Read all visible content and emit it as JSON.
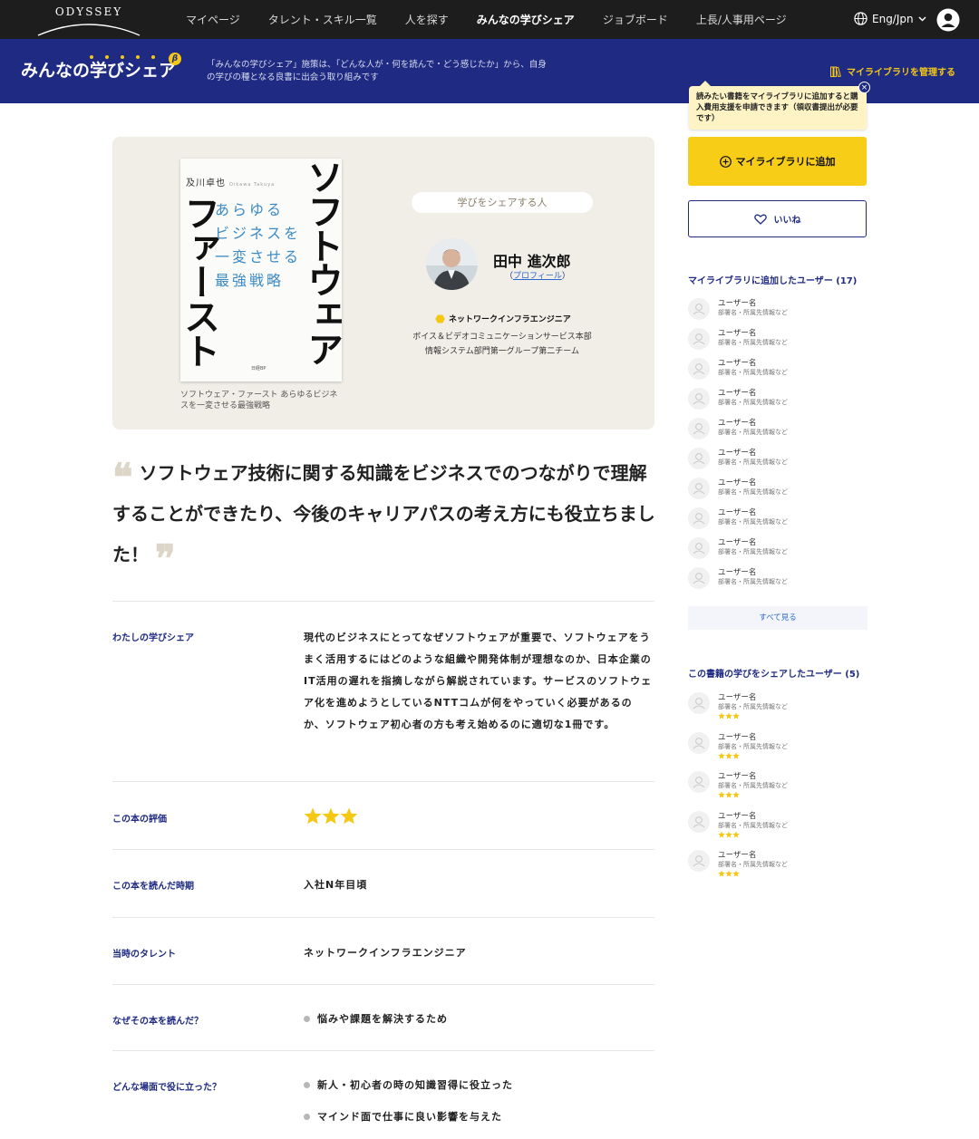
{
  "nav": {
    "logo": "ODYSSEY",
    "links": [
      "マイページ",
      "タレント・スキル一覧",
      "人を探す",
      "みんなの学びシェア",
      "ジョブボード",
      "上長/人事用ページ"
    ],
    "active_index": 3,
    "language": "Eng/Jpn",
    "account_icon": "user-circle-icon"
  },
  "banner": {
    "brand": "みんなの学びシェア",
    "beta": "β",
    "description": "「みんなの学びシェア」施策は、「どんな人が・何を読んで・どう感じたか」から、自身の学びの種となる良書に出会う取り組みです",
    "manage_library": "マイライブラリを管理する"
  },
  "tooltip": {
    "text": "読みたい書籍をマイライブラリに追加すると購入費用支援を申請できます（領収書提出が必要です）",
    "close": "×"
  },
  "book": {
    "cover_author": "及川卓也",
    "cover_author_roman": "Oikawa Takuya",
    "cover_subtitle": [
      "あらゆる",
      "ビジネスを",
      "一変させる",
      "最強戦略"
    ],
    "cover_title_right": "ソフトウェア",
    "cover_title_left": "ファースト",
    "cover_publisher": "日経BP",
    "caption": "ソフトウェア・ファースト あらゆるビジネスを一変させる最強戦略"
  },
  "sharer": {
    "heading": "学びをシェアする人",
    "name": "田中 進次郎",
    "profile_prefix": "（",
    "profile_link": "プロフィール",
    "profile_suffix": "）",
    "talent": "ネットワークインフラエンジニア",
    "department_line1": "ボイス＆ビデオコミュニケーションサービス本部",
    "department_line2": "情報システム部門第一グループ第二チーム"
  },
  "quote": {
    "open_mark": "❝",
    "text": "ソフトウェア技術に関する知識をビジネスでのつながりで理解することができたり、今後のキャリアパスの考え方にも役立ちました！",
    "close_mark": "❞"
  },
  "details": {
    "review_label": "わたしの学びシェア",
    "review_text": "現代のビジネスにとってなぜソフトウェアが重要で、ソフトウェアをうまく活用するにはどのような組織や開発体制が理想なのか、日本企業のIT活用の遅れを指摘しながら解説されています。サービスのソフトウェア化を進めようとしているNTTコムが何をやっていく必要があるのか、ソフトウェア初心者の方も考え始めるのに適切な1冊です。",
    "rating_label": "この本の評価",
    "rating": 3,
    "period_label": "この本を読んだ時期",
    "period_value": "入社N年目頃",
    "talent_label": "当時のタレント",
    "talent_value": "ネットワークインフラエンジニア",
    "why_label": "なぜその本を読んだ？",
    "why_items": [
      "悩みや課題を解決するため"
    ],
    "useful_label": "どんな場面で役に立った？",
    "useful_items": [
      "新人・初心者の時の知識習得に役立った",
      "マインド面で仕事に良い影響を与えた"
    ]
  },
  "sidebar": {
    "add_button": "マイライブラリに追加",
    "like_button": "いいね",
    "library_users_title": "マイライブラリに追加したユーザー (17)",
    "library_users": [
      {
        "name": "ユーザー名",
        "dept": "部署名・所属先情報など"
      },
      {
        "name": "ユーザー名",
        "dept": "部署名・所属先情報など"
      },
      {
        "name": "ユーザー名",
        "dept": "部署名・所属先情報など"
      },
      {
        "name": "ユーザー名",
        "dept": "部署名・所属先情報など"
      },
      {
        "name": "ユーザー名",
        "dept": "部署名・所属先情報など"
      },
      {
        "name": "ユーザー名",
        "dept": "部署名・所属先情報など"
      },
      {
        "name": "ユーザー名",
        "dept": "部署名・所属先情報など"
      },
      {
        "name": "ユーザー名",
        "dept": "部署名・所属先情報など"
      },
      {
        "name": "ユーザー名",
        "dept": "部署名・所属先情報など"
      },
      {
        "name": "ユーザー名",
        "dept": "部署名・所属先情報など"
      }
    ],
    "see_all": "すべて見る",
    "share_users_title": "この書籍の学びをシェアしたユーザー (5)",
    "share_users": [
      {
        "name": "ユーザー名",
        "dept": "部署名・所属先情報など",
        "rating": 3
      },
      {
        "name": "ユーザー名",
        "dept": "部署名・所属先情報など",
        "rating": 3
      },
      {
        "name": "ユーザー名",
        "dept": "部署名・所属先情報など",
        "rating": 3
      },
      {
        "name": "ユーザー名",
        "dept": "部署名・所属先情報など",
        "rating": 3
      },
      {
        "name": "ユーザー名",
        "dept": "部署名・所属先情報など",
        "rating": 3
      }
    ]
  },
  "colors": {
    "nav_bg": "#1d1d1d",
    "brand_blue": "#1f2b82",
    "accent_yellow": "#f7cd17",
    "card_bg": "#f1eee8",
    "star": "#f5c816"
  }
}
